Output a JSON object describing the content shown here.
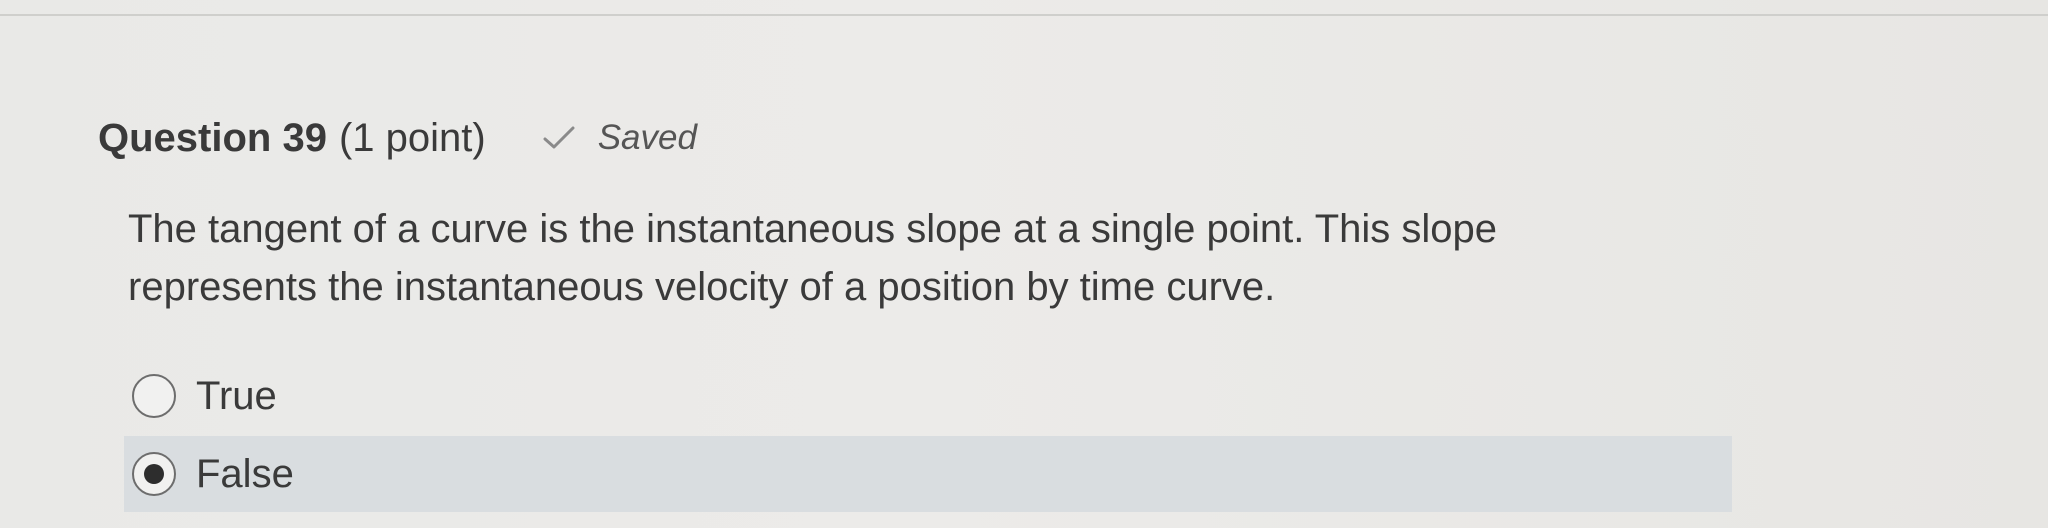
{
  "question": {
    "title": "Question 39",
    "points": "(1 point)",
    "status": "Saved",
    "status_icon": "check-icon",
    "text": "The tangent of a curve is the instantaneous slope at a single point. This slope represents the instantaneous velocity of a position by time curve."
  },
  "answers": [
    {
      "label": "True",
      "selected": false
    },
    {
      "label": "False",
      "selected": true
    }
  ],
  "colors": {
    "background": "#ebeae8",
    "selected_row": "#d9dde0",
    "text": "#3a3a3a"
  }
}
